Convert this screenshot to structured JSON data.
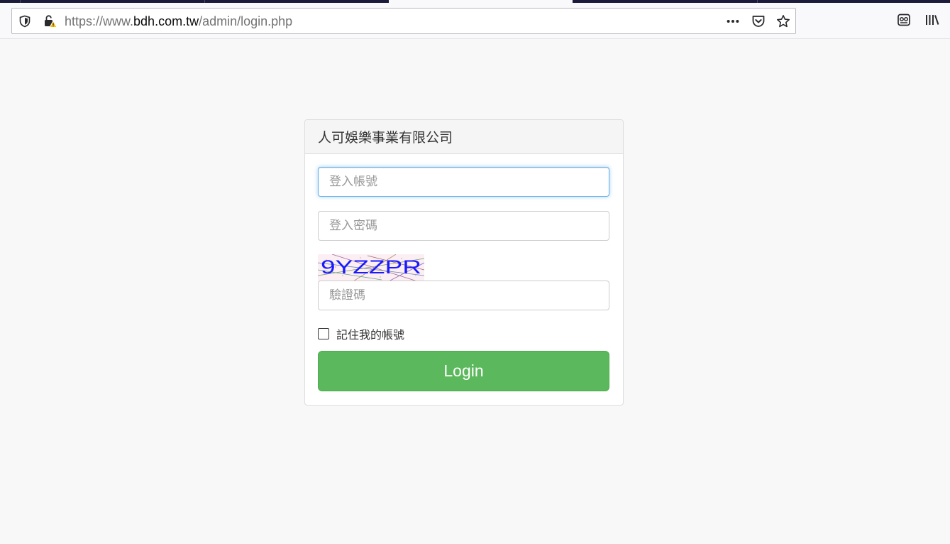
{
  "browser": {
    "url_scheme": "https://www.",
    "url_host": "bdh.com.tw",
    "url_path": "/admin/login.php",
    "icons": {
      "tracking": "shield-icon",
      "security": "insecure-lock-warning-icon",
      "page_actions": "more-dots-icon",
      "pocket": "pocket-icon",
      "bookmark": "star-icon",
      "reader": "reader-view-icon",
      "library": "library-icon"
    }
  },
  "login": {
    "company_name": "人可娛樂事業有限公司",
    "username_placeholder": "登入帳號",
    "password_placeholder": "登入密碼",
    "captcha_text": "9YZZPR",
    "captcha_placeholder": "驗證碼",
    "remember_label": "記住我的帳號",
    "remember_checked": false,
    "submit_label": "Login"
  },
  "colors": {
    "login_button": "#5cb85c",
    "focus_border": "#66afe9",
    "captcha_text": "#1a1aff",
    "page_background": "#f8f8f8"
  }
}
